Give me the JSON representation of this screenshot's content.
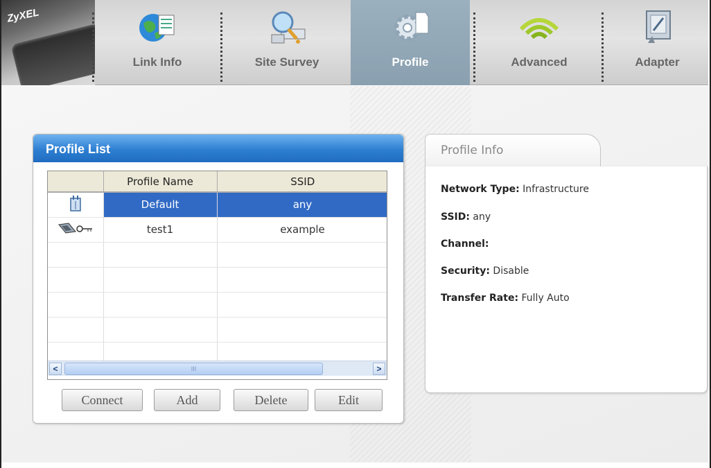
{
  "nav": {
    "brand_text": "ZyXEL",
    "items": [
      {
        "label": "Link Info",
        "icon": "globe-document-icon"
      },
      {
        "label": "Site Survey",
        "icon": "network-search-icon"
      },
      {
        "label": "Profile",
        "icon": "gear-profile-icon"
      },
      {
        "label": "Advanced",
        "icon": "wifi-waves-icon"
      },
      {
        "label": "Adapter",
        "icon": "adapter-card-icon"
      }
    ],
    "active": "Profile"
  },
  "profile_list": {
    "title": "Profile List",
    "columns": [
      "",
      "Profile Name",
      "SSID"
    ],
    "rows": [
      {
        "icon": "infrastructure-ap-icon",
        "name": "Default",
        "ssid": "any",
        "selected": true
      },
      {
        "icon": "adhoc-key-icon",
        "name": "test1",
        "ssid": "example",
        "selected": false
      }
    ],
    "scroll_thumb_text": "III",
    "buttons": {
      "connect": "Connect",
      "add": "Add",
      "delete": "Delete",
      "edit": "Edit"
    }
  },
  "profile_info": {
    "title": "Profile Info",
    "network_type": {
      "label": "Network Type:",
      "value": "Infrastructure"
    },
    "ssid": {
      "label": "SSID:",
      "value": "any"
    },
    "channel": {
      "label": "Channel:",
      "value": ""
    },
    "security": {
      "label": "Security:",
      "value": "Disable"
    },
    "transfer_rate": {
      "label": "Transfer Rate:",
      "value": "Fully Auto"
    }
  },
  "colors": {
    "selection": "#316ac5",
    "title_bar": "#2d7fd2",
    "active_tab": "#8aa0b0"
  }
}
